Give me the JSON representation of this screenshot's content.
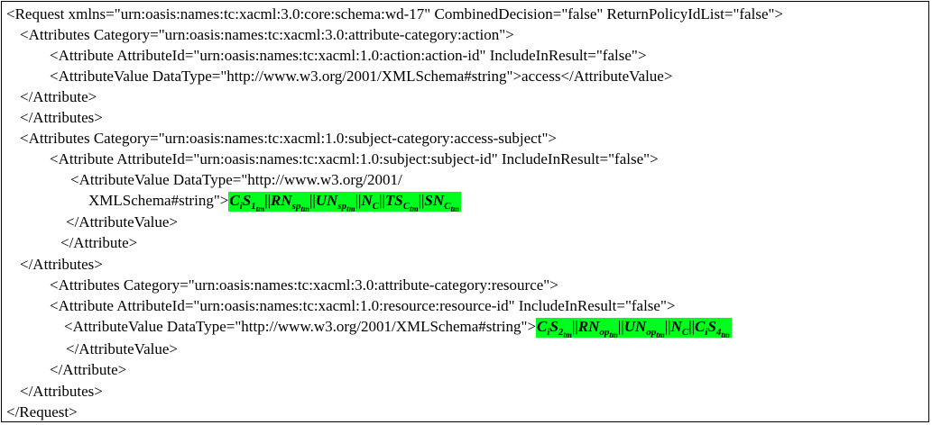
{
  "lines": [
    "<Request xmlns=\"urn:oasis:names:tc:xacml:3.0:core:schema:wd-17\" CombinedDecision=\"false\" ReturnPolicyIdList=\"false\">",
    "<Attributes Category=\"urn:oasis:names:tc:xacml:3.0:attribute-category:action\">",
    "<Attribute AttributeId=\"urn:oasis:names:tc:xacml:1.0:action:action-id\" IncludeInResult=\"false\">",
    "<AttributeValue DataType=\"http://www.w3.org/2001/XMLSchema#string\">access</AttributeValue>",
    "</Attribute>",
    "</Attributes>",
    "<Attributes Category=\"urn:oasis:names:tc:xacml:1.0:subject-category:access-subject\">",
    "<Attribute AttributeId=\"urn:oasis:names:tc:xacml:1.0:subject:subject-id\" IncludeInResult=\"false\">",
    "<AttributeValue DataType=\"http://www.w3.org/2001/",
    "XMLSchema#string\">",
    "</AttributeValue>",
    "</Attribute>",
    "</Attributes>",
    "<Attributes Category=\"urn:oasis:names:tc:xacml:3.0:attribute-category:resource\">",
    "<Attribute AttributeId=\"urn:oasis:names:tc:xacml:1.0:resource:resource-id\" IncludeInResult=\"false\">",
    "<AttributeValue DataType=\"http://www.w3.org/2001/XMLSchema#string\">",
    "</AttributeValue>",
    "</Attribute>",
    "</Attributes>",
    "</Request>"
  ],
  "subject_value": {
    "terms": [
      {
        "base": "C",
        "sub": "i"
      },
      {
        "base": "S",
        "sub": "1",
        "subsub": "tm"
      },
      {
        "base": "RN",
        "sub": "sp",
        "subsub": "tm"
      },
      {
        "base": "UN",
        "sub": "sp",
        "subsub": "tm"
      },
      {
        "base": "N",
        "sub": "C"
      },
      {
        "base": "TS",
        "sub": "C",
        "subsub": "tm"
      },
      {
        "base": "SN",
        "sub": "C",
        "subsub": "tm"
      }
    ],
    "separator": "||"
  },
  "resource_value": {
    "terms": [
      {
        "base": "C",
        "sub": "i"
      },
      {
        "base": "S",
        "sub": "2",
        "subsub": "tm"
      },
      {
        "base": "RN",
        "sub": "op",
        "subsub": "tm"
      },
      {
        "base": "UN",
        "sub": "op",
        "subsub": "tm"
      },
      {
        "base": "N",
        "sub": "C"
      },
      {
        "base": "C",
        "sub": "i"
      },
      {
        "base": "S",
        "sub": "4",
        "subsub": "tm"
      }
    ],
    "separator": "||"
  },
  "colors": {
    "highlight": "#00ff1e",
    "text": "#000000",
    "border": "#000000"
  }
}
